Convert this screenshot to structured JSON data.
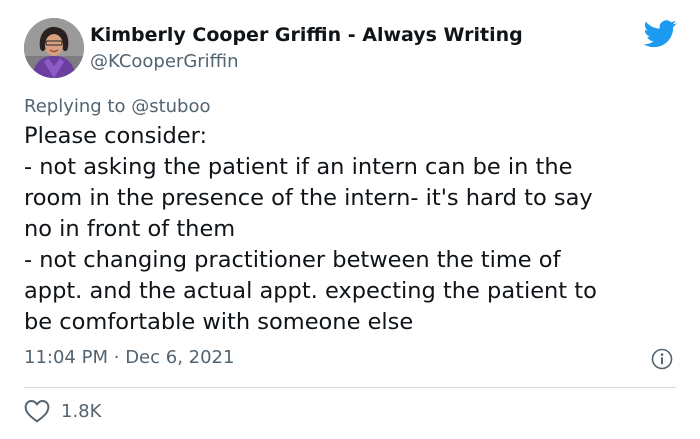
{
  "author": {
    "display_name": "Kimberly Cooper Griffin - Always Writing",
    "handle": "@KCooperGriffin",
    "avatar_icon": "profile-photo"
  },
  "platform_icon": "twitter-bird-icon",
  "reply": {
    "prefix": "Replying to ",
    "target": "@stuboo"
  },
  "body_lines": [
    "Please consider:",
    "- not asking the patient if an intern can be in the",
    "room in the presence of the intern- it's hard to say",
    "no in front of them",
    "- not changing practitioner between the time of",
    "appt. and the actual appt. expecting the patient to",
    "be comfortable with someone else"
  ],
  "meta": {
    "time": "11:04 PM",
    "separator": "·",
    "date": "Dec 6, 2021"
  },
  "engagement": {
    "likes": "1.8K"
  },
  "colors": {
    "text": "#0f1419",
    "secondary": "#536471",
    "link": "#1d9bf0",
    "divider": "#cfd9de"
  }
}
